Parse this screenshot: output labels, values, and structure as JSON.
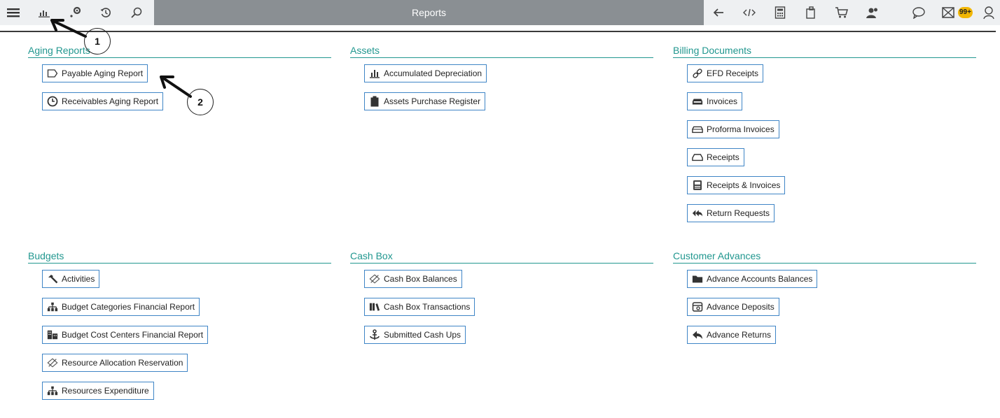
{
  "topbar": {
    "title": "Reports",
    "badge": "99+"
  },
  "sections": {
    "aging": {
      "title": "Aging Reports",
      "items": [
        "Payable Aging Report",
        "Receivables Aging Report"
      ]
    },
    "assets": {
      "title": "Assets",
      "items": [
        "Accumulated Depreciation",
        "Assets Purchase Register"
      ]
    },
    "billing": {
      "title": "Billing Documents",
      "items": [
        "EFD Receipts",
        "Invoices",
        "Proforma Invoices",
        "Receipts",
        "Receipts & Invoices",
        "Return Requests"
      ]
    },
    "budgets": {
      "title": "Budgets",
      "items": [
        "Activities",
        "Budget Categories Financial Report",
        "Budget Cost Centers Financial Report",
        "Resource Allocation Reservation",
        "Resources Expenditure"
      ]
    },
    "cashbox": {
      "title": "Cash Box",
      "items": [
        "Cash Box Balances",
        "Cash Box Transactions",
        "Submitted Cash Ups"
      ]
    },
    "advances": {
      "title": "Customer Advances",
      "items": [
        "Advance Accounts Balances",
        "Advance Deposits",
        "Advance Returns"
      ]
    }
  },
  "annotations": [
    "1",
    "2"
  ],
  "colors": {
    "accent": "#21978f",
    "button_border": "#3f85c6",
    "topbar_center": "#8a8f93"
  }
}
